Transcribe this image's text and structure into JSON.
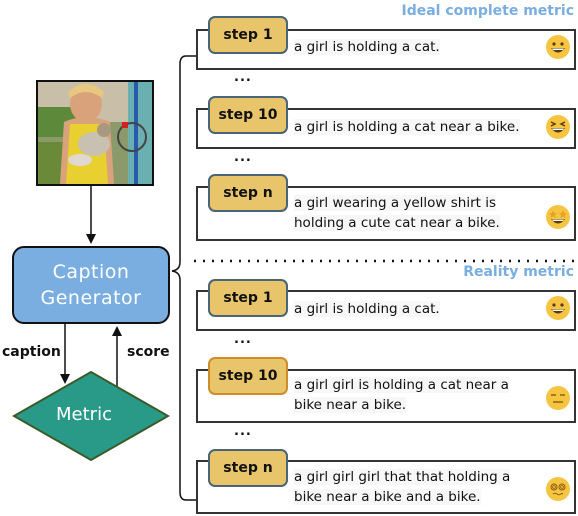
{
  "left_panel": {
    "photo_alt": "girl in yellow shirt holding a cat near a bike",
    "generator_label_line1": "Caption",
    "generator_label_line2": "Generator",
    "metric_label": "Metric",
    "caption_arrow_label": "caption",
    "score_arrow_label": "score"
  },
  "ideal": {
    "title": "Ideal complete metric",
    "steps": [
      {
        "label": "step 1",
        "lines": [
          "a girl is holding a cat."
        ],
        "emoji": "grinning-face-icon"
      },
      {
        "label": "step 10",
        "lines": [
          "a girl is holding a cat near a bike."
        ],
        "emoji": "squinting-face-icon"
      },
      {
        "label": "step n",
        "lines": [
          "a girl wearing a yellow shirt is",
          "holding a cute cat near a bike."
        ],
        "emoji": "star-struck-icon"
      }
    ],
    "ellipsis": "..."
  },
  "reality": {
    "title": "Reality metric",
    "steps": [
      {
        "label": "step 1",
        "lines": [
          "a girl is holding a cat."
        ],
        "emoji": "grinning-face-icon"
      },
      {
        "label": "step 10",
        "lines": [
          "a girl girl is holding a cat near a",
          "bike near a bike."
        ],
        "emoji": "expressionless-face-icon"
      },
      {
        "label": "step n",
        "lines": [
          "a girl girl girl that that holding a",
          "bike near a bike and a bike."
        ],
        "emoji": "dizzy-face-icon"
      }
    ],
    "ellipsis": "..."
  },
  "colors": {
    "generator_fill": "#7aaee0",
    "metric_fill": "#2a9a88",
    "step_fill": "#e8c56a",
    "step_border": "#4a6577",
    "step_border_highlight": "#d08b2c",
    "section_title": "#7aaee0"
  }
}
